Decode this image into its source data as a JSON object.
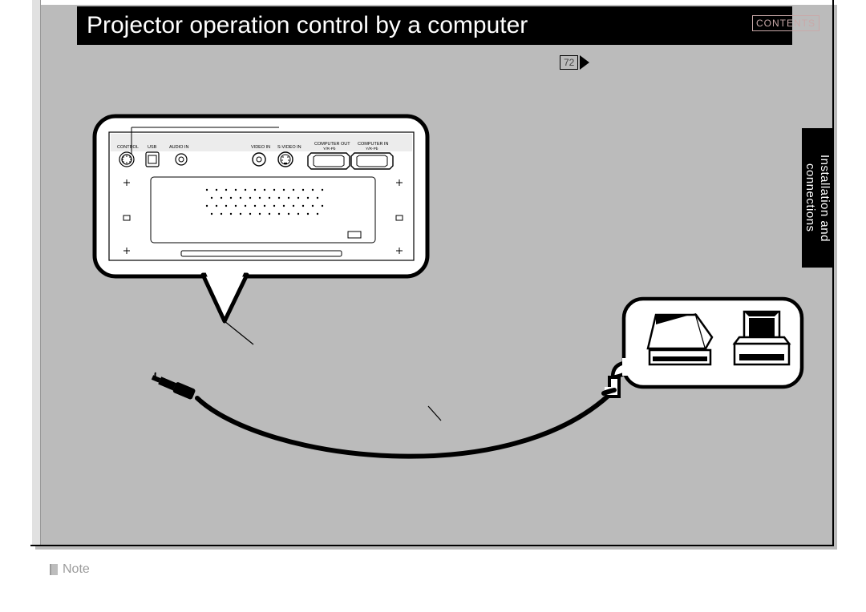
{
  "title": "Projector operation control by a computer",
  "contents_label": "CONTENTS",
  "page_number": "72",
  "side_tab": {
    "line1": "Installation and",
    "line2": "connections"
  },
  "note_label": "Note",
  "ports": {
    "control": "CONTROL",
    "usb": "USB",
    "audio_in": "AUDIO IN",
    "video_in": "VIDEO IN",
    "s_video_in": "S-VIDEO IN",
    "computer_out": "COMPUTER OUT",
    "computer_in": "COMPUTER IN",
    "yr_pb": "Y/R-Pb"
  }
}
